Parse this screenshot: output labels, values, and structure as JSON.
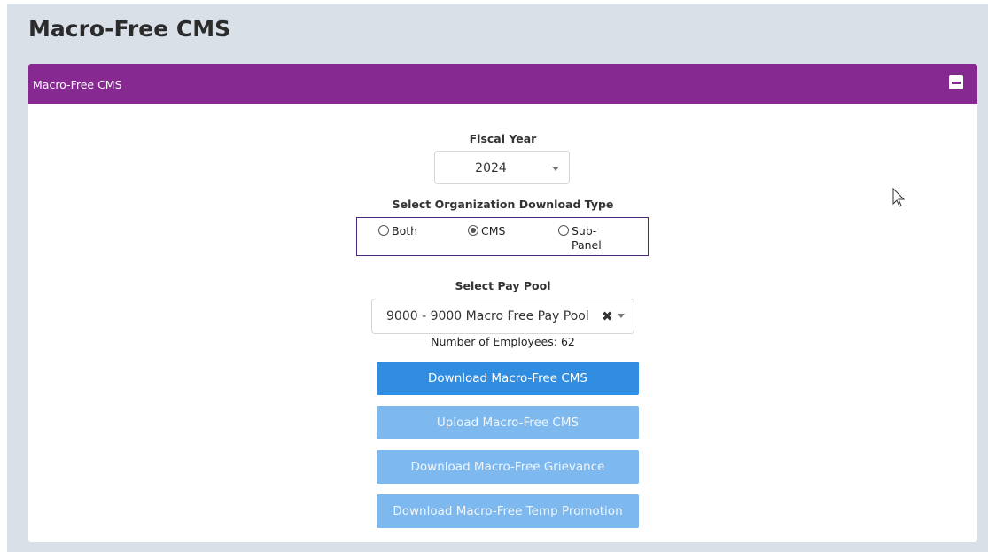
{
  "page": {
    "title": "Macro-Free CMS"
  },
  "panel": {
    "header_title": "Macro-Free CMS"
  },
  "fiscal_year": {
    "label": "Fiscal Year",
    "selected": "2024"
  },
  "download_type": {
    "label": "Select Organization Download Type",
    "options": [
      {
        "label": "Both",
        "checked": false
      },
      {
        "label": "CMS",
        "checked": true
      },
      {
        "label": "Sub-",
        "label2": "Panel",
        "checked": false
      }
    ]
  },
  "pay_pool": {
    "label": "Select Pay Pool",
    "selected": "9000 - 9000 Macro Free Pay Pool",
    "clear_glyph": "✖"
  },
  "employees": {
    "text": "Number of Employees: 62"
  },
  "buttons": {
    "download_cms": "Download Macro-Free CMS",
    "upload_cms": "Upload Macro-Free CMS",
    "download_grievance": "Download Macro-Free Grievance",
    "download_temp_promotion": "Download Macro-Free Temp Promotion"
  },
  "colors": {
    "header": "#862a91",
    "primary_button": "#318de0",
    "disabled_button": "#7db8ee",
    "page_background": "#d9e0e8"
  }
}
